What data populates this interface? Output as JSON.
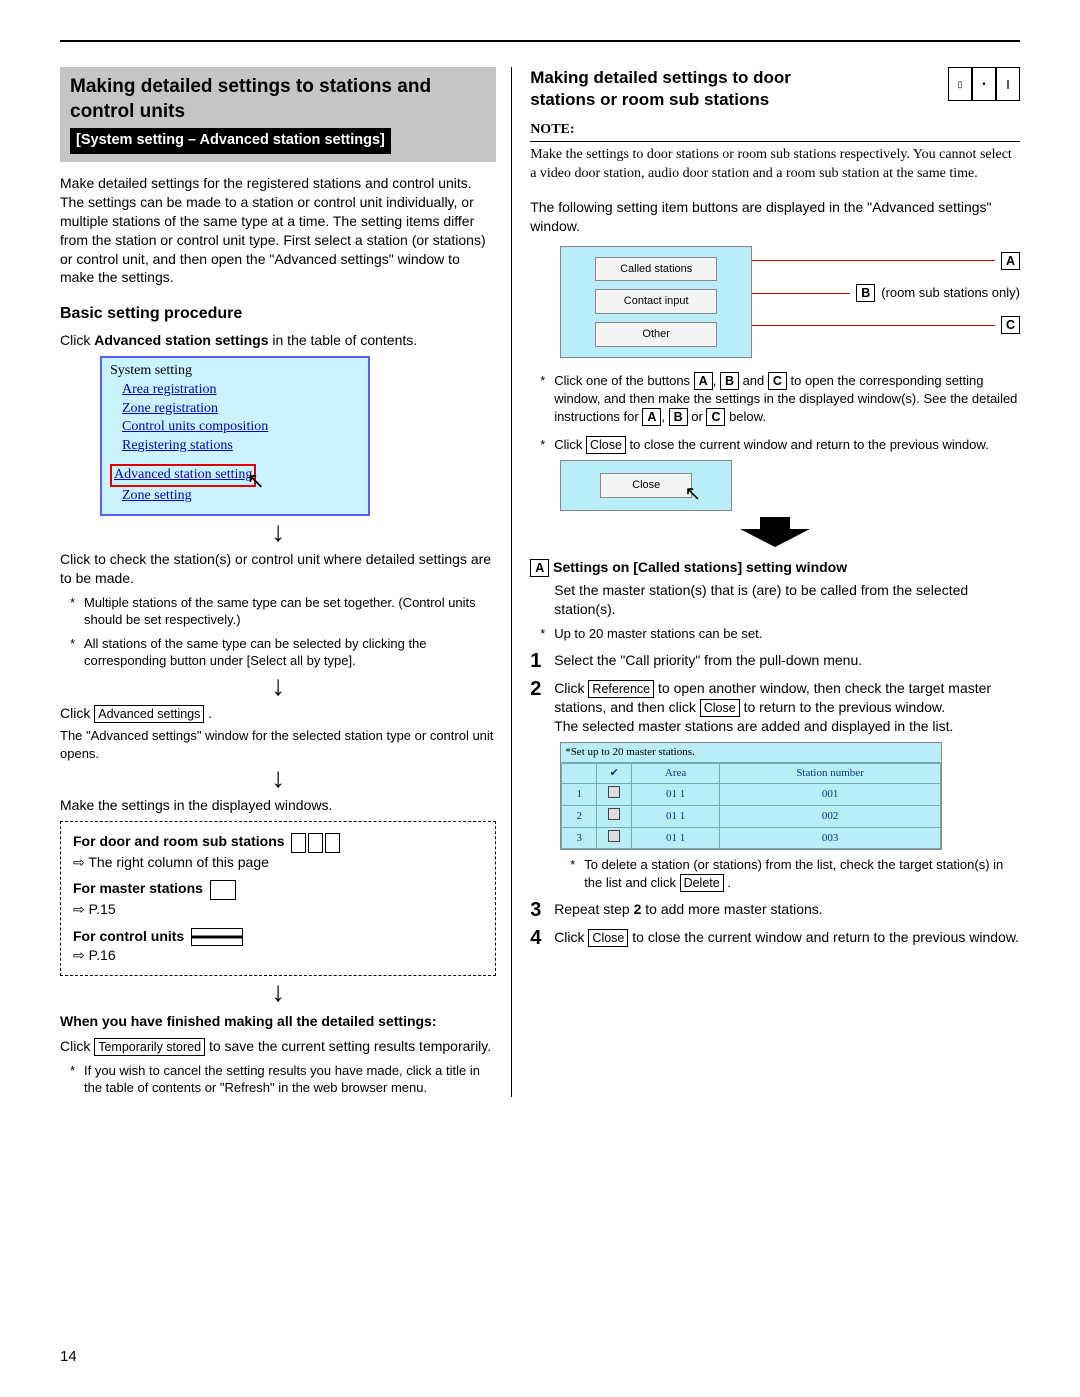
{
  "left": {
    "gray_title": "Making detailed settings to stations and control units",
    "black_sub": "[System setting – Advanced station settings]",
    "intro": "Make detailed settings for the registered stations and control units. The settings can be made to a station or control unit individually, or multiple stations of the same type at a time. The setting items differ from the station or control unit type. First select a station (or stations) or control unit, and then open the \"Advanced settings\" window to make the settings.",
    "h3_basic": "Basic setting procedure",
    "click_adv_1a": "Click ",
    "click_adv_bold": "Advanced station settings",
    "click_adv_1b": " in the table of contents.",
    "toc": {
      "hdr": "System setting",
      "items": [
        "Area registration",
        "Zone registration",
        "Control units composition",
        "Registering stations",
        "Advanced station setting",
        "Zone setting"
      ]
    },
    "click_check": "Click to check the station(s) or control unit where detailed settings are to be made.",
    "bullet1": "Multiple stations of the same type can be set together. (Control units should be set respectively.)",
    "bullet2": "All stations of the same type can be selected by clicking the corresponding button under [Select all by type].",
    "click_word": "Click ",
    "adv_settings_btn": "Advanced settings",
    "after_click": "The \"Advanced settings\" window for the selected station type or control unit opens.",
    "make_settings": "Make the settings in the displayed windows.",
    "dashed": {
      "l1": "For door and room sub stations",
      "l1b": "The right column of this page",
      "l2": "For master stations",
      "l2b": "P.15",
      "l3": "For control units",
      "l3b": "P.16"
    },
    "finished_bold": "When you have finished making all the detailed settings:",
    "click_temp_a": "Click ",
    "temp_btn": "Temporarily stored",
    "click_temp_b": " to save the current setting results temporarily.",
    "cancel_note": "If you wish to cancel the setting results you have made, click a title in the table of contents or \"Refresh\" in the web browser menu."
  },
  "right": {
    "title": "Making detailed settings to door stations or room sub stations",
    "note_label": "NOTE:",
    "note_text": "Make the settings to door stations or room sub stations respectively. You cannot select a video door station, audio door station and a room sub station at the same time.",
    "following": "The following setting item buttons are displayed in the \"Advanced settings\" window.",
    "buttons": {
      "a": "Called stations",
      "b": "Contact input",
      "c": "Other",
      "b_note": "(room sub stations only)"
    },
    "labels": {
      "A": "A",
      "B": "B",
      "C": "C"
    },
    "bullet_open_a": "Click one of the buttons ",
    "bullet_open_mid": " and ",
    "bullet_open_b": " to open the corresponding setting window, and then make the settings in the displayed window(s). See the detailed instructions for ",
    "bullet_open_c": " below.",
    "or_word": " or ",
    "comma": ", ",
    "bullet_close_a": "Click ",
    "close_btn": "Close",
    "bullet_close_b": " to close the current window and return to the previous window.",
    "sec_a_title": "Settings on [Called stations] setting window",
    "sec_a_desc": "Set the master station(s) that is (are) to be called from the selected station(s).",
    "sec_a_note": "Up to 20 master stations can be set.",
    "step1": "Select the \"Call priority\" from the pull-down menu.",
    "step2a": "Click ",
    "reference_btn": "Reference",
    "step2b": " to open another window, then check the target master stations, and then click ",
    "step2c": " to return to the previous window.\nThe selected master stations are added and displayed in the list.",
    "table_caption": "*Set up to 20 master stations.",
    "table_headers": {
      "chk": "✔",
      "area": "Area",
      "sn": "Station number"
    },
    "chart_data": {
      "type": "table",
      "columns": [
        "#",
        "Area",
        "Station number"
      ],
      "rows": [
        [
          "1",
          "01 1",
          "001"
        ],
        [
          "2",
          "01 1",
          "002"
        ],
        [
          "3",
          "01 1",
          "003"
        ]
      ]
    },
    "delete_note_a": "To delete a station (or stations) from the list, check the target station(s) in the list and click ",
    "delete_btn": "Delete",
    "step3a": "Repeat step ",
    "step3bold": "2",
    "step3b": " to add more master stations.",
    "step4a": "Click ",
    "step4b": " to close the current window and return to the previous window."
  },
  "page_number": "14"
}
